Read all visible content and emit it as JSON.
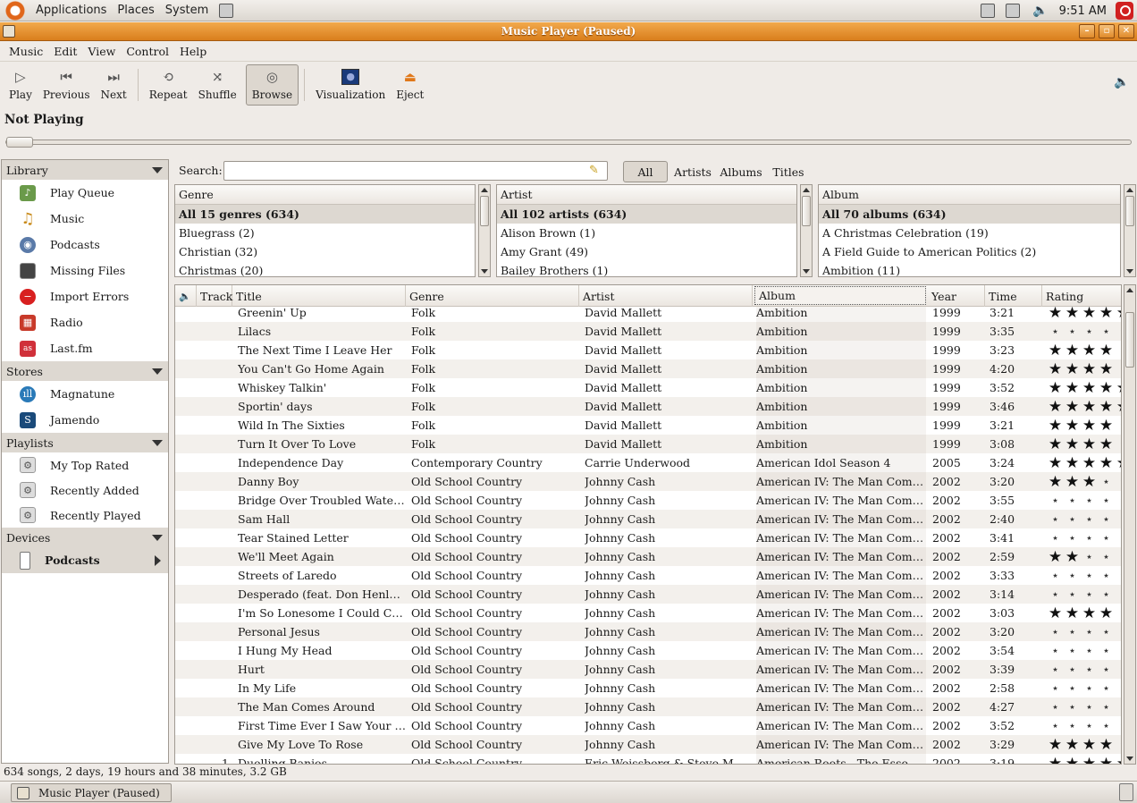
{
  "top_panel": {
    "menus": [
      "Applications",
      "Places",
      "System"
    ],
    "clock": "9:51 AM"
  },
  "window": {
    "title": "Music Player (Paused)"
  },
  "menubar": [
    "Music",
    "Edit",
    "View",
    "Control",
    "Help"
  ],
  "toolbar": {
    "play": "Play",
    "previous": "Previous",
    "next": "Next",
    "repeat": "Repeat",
    "shuffle": "Shuffle",
    "browse": "Browse",
    "visualization": "Visualization",
    "eject": "Eject"
  },
  "now_playing": "Not Playing",
  "sidebar": {
    "library_header": "Library",
    "library": [
      "Play Queue",
      "Music",
      "Podcasts",
      "Missing Files",
      "Import Errors",
      "Radio",
      "Last.fm"
    ],
    "stores_header": "Stores",
    "stores": [
      "Magnatune",
      "Jamendo"
    ],
    "playlists_header": "Playlists",
    "playlists": [
      "My Top Rated",
      "Recently Added",
      "Recently Played"
    ],
    "devices_header": "Devices",
    "devices": [
      "Podcasts"
    ]
  },
  "search": {
    "label": "Search:",
    "value": "",
    "filters": [
      "All",
      "Artists",
      "Albums",
      "Titles"
    ],
    "active_filter": "All"
  },
  "browser": {
    "genre": {
      "header": "Genre",
      "items": [
        "All 15 genres (634)",
        "Bluegrass (2)",
        "Christian (32)",
        "Christmas (20)"
      ]
    },
    "artist": {
      "header": "Artist",
      "items": [
        "All 102 artists (634)",
        "Alison Brown (1)",
        "Amy Grant (49)",
        "Bailey Brothers (1)"
      ]
    },
    "album": {
      "header": "Album",
      "items": [
        "All 70 albums (634)",
        "A Christmas Celebration (19)",
        "A Field Guide to American Politics (2)",
        "Ambition (11)"
      ]
    }
  },
  "table": {
    "columns": [
      "Track",
      "Title",
      "Genre",
      "Artist",
      "Album",
      "Year",
      "Time",
      "Rating"
    ],
    "sorted_column": "Album",
    "rows": [
      {
        "track": "",
        "title": "Greenin' Up",
        "genre": "Folk",
        "artist": "David Mallett",
        "album": "Ambition",
        "year": "1999",
        "time": "3:21",
        "rating": 5
      },
      {
        "track": "",
        "title": "Lilacs",
        "genre": "Folk",
        "artist": "David Mallett",
        "album": "Ambition",
        "year": "1999",
        "time": "3:35",
        "rating": 0
      },
      {
        "track": "",
        "title": "The Next Time I Leave Her",
        "genre": "Folk",
        "artist": "David Mallett",
        "album": "Ambition",
        "year": "1999",
        "time": "3:23",
        "rating": 4
      },
      {
        "track": "",
        "title": "You Can't Go Home Again",
        "genre": "Folk",
        "artist": "David Mallett",
        "album": "Ambition",
        "year": "1999",
        "time": "4:20",
        "rating": 4
      },
      {
        "track": "",
        "title": "Whiskey Talkin'",
        "genre": "Folk",
        "artist": "David Mallett",
        "album": "Ambition",
        "year": "1999",
        "time": "3:52",
        "rating": 5
      },
      {
        "track": "",
        "title": "Sportin' days",
        "genre": "Folk",
        "artist": "David Mallett",
        "album": "Ambition",
        "year": "1999",
        "time": "3:46",
        "rating": 5
      },
      {
        "track": "",
        "title": "Wild In The Sixties",
        "genre": "Folk",
        "artist": "David Mallett",
        "album": "Ambition",
        "year": "1999",
        "time": "3:21",
        "rating": 4
      },
      {
        "track": "",
        "title": "Turn It Over To Love",
        "genre": "Folk",
        "artist": "David Mallett",
        "album": "Ambition",
        "year": "1999",
        "time": "3:08",
        "rating": 4
      },
      {
        "track": "",
        "title": "Independence Day",
        "genre": "Contemporary Country",
        "artist": "Carrie Underwood",
        "album": "American Idol Season 4",
        "year": "2005",
        "time": "3:24",
        "rating": 5
      },
      {
        "track": "",
        "title": "Danny Boy",
        "genre": "Old School Country",
        "artist": "Johnny Cash",
        "album": "American IV: The Man Comes ...",
        "year": "2002",
        "time": "3:20",
        "rating": 3
      },
      {
        "track": "",
        "title": "Bridge Over Troubled Water (f...",
        "genre": "Old School Country",
        "artist": "Johnny Cash",
        "album": "American IV: The Man Comes ...",
        "year": "2002",
        "time": "3:55",
        "rating": 0
      },
      {
        "track": "",
        "title": "Sam Hall",
        "genre": "Old School Country",
        "artist": "Johnny Cash",
        "album": "American IV: The Man Comes ...",
        "year": "2002",
        "time": "2:40",
        "rating": 0
      },
      {
        "track": "",
        "title": "Tear Stained Letter",
        "genre": "Old School Country",
        "artist": "Johnny Cash",
        "album": "American IV: The Man Comes ...",
        "year": "2002",
        "time": "3:41",
        "rating": 0
      },
      {
        "track": "",
        "title": "We'll Meet Again",
        "genre": "Old School Country",
        "artist": "Johnny Cash",
        "album": "American IV: The Man Comes ...",
        "year": "2002",
        "time": "2:59",
        "rating": 2
      },
      {
        "track": "",
        "title": "Streets of Laredo",
        "genre": "Old School Country",
        "artist": "Johnny Cash",
        "album": "American IV: The Man Comes ...",
        "year": "2002",
        "time": "3:33",
        "rating": 0
      },
      {
        "track": "",
        "title": "Desperado (feat. Don Henley)",
        "genre": "Old School Country",
        "artist": "Johnny Cash",
        "album": "American IV: The Man Comes ...",
        "year": "2002",
        "time": "3:14",
        "rating": 0
      },
      {
        "track": "",
        "title": "I'm So Lonesome I Could Cry (f...",
        "genre": "Old School Country",
        "artist": "Johnny Cash",
        "album": "American IV: The Man Comes ...",
        "year": "2002",
        "time": "3:03",
        "rating": 4
      },
      {
        "track": "",
        "title": "Personal Jesus",
        "genre": "Old School Country",
        "artist": "Johnny Cash",
        "album": "American IV: The Man Comes ...",
        "year": "2002",
        "time": "3:20",
        "rating": 0
      },
      {
        "track": "",
        "title": "I Hung My Head",
        "genre": "Old School Country",
        "artist": "Johnny Cash",
        "album": "American IV: The Man Comes ...",
        "year": "2002",
        "time": "3:54",
        "rating": 0
      },
      {
        "track": "",
        "title": "Hurt",
        "genre": "Old School Country",
        "artist": "Johnny Cash",
        "album": "American IV: The Man Comes ...",
        "year": "2002",
        "time": "3:39",
        "rating": 0
      },
      {
        "track": "",
        "title": "In My Life",
        "genre": "Old School Country",
        "artist": "Johnny Cash",
        "album": "American IV: The Man Comes ...",
        "year": "2002",
        "time": "2:58",
        "rating": 0
      },
      {
        "track": "",
        "title": "The Man Comes Around",
        "genre": "Old School Country",
        "artist": "Johnny Cash",
        "album": "American IV: The Man Comes ...",
        "year": "2002",
        "time": "4:27",
        "rating": 0
      },
      {
        "track": "",
        "title": "First Time Ever I Saw Your Face",
        "genre": "Old School Country",
        "artist": "Johnny Cash",
        "album": "American IV: The Man Comes ...",
        "year": "2002",
        "time": "3:52",
        "rating": 0
      },
      {
        "track": "",
        "title": "Give My Love To Rose",
        "genre": "Old School Country",
        "artist": "Johnny Cash",
        "album": "American IV: The Man Comes ...",
        "year": "2002",
        "time": "3:29",
        "rating": 4
      },
      {
        "track": "1",
        "title": "Duelling Banjos",
        "genre": "Old School Country",
        "artist": "Eric Weissberg & Steve Mandell",
        "album": "American Roots - The Essential...",
        "year": "2002",
        "time": "3:19",
        "rating": 5
      }
    ]
  },
  "status": "634 songs, 2 days, 19 hours and 38 minutes, 3.2 GB",
  "taskbar": {
    "window_button": "Music Player (Paused)"
  }
}
